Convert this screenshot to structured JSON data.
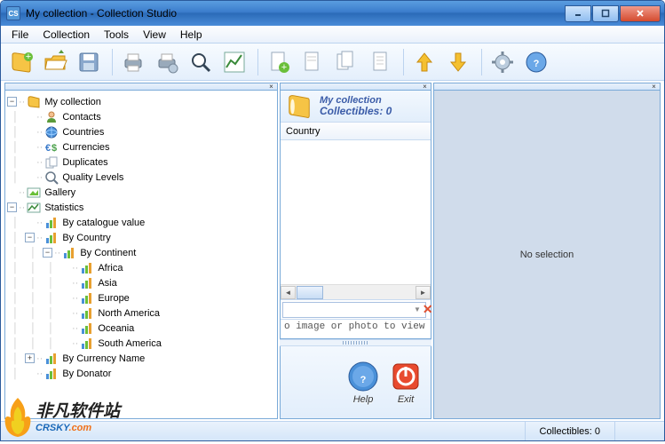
{
  "window": {
    "title": "My collection - Collection Studio",
    "app_icon": "CS"
  },
  "menu": [
    "File",
    "Collection",
    "Tools",
    "View",
    "Help"
  ],
  "toolbar": {
    "items": [
      "book-new",
      "folder-open",
      "save",
      "",
      "print",
      "print-setup",
      "search",
      "chart",
      "",
      "page-add",
      "page-remove",
      "page-copy",
      "page",
      "",
      "up",
      "down",
      "",
      "gear",
      "help"
    ]
  },
  "tree": [
    {
      "depth": 0,
      "exp": "-",
      "icon": "book",
      "label": "My collection"
    },
    {
      "depth": 1,
      "exp": "",
      "icon": "contacts",
      "label": "Contacts"
    },
    {
      "depth": 1,
      "exp": "",
      "icon": "globe",
      "label": "Countries"
    },
    {
      "depth": 1,
      "exp": "",
      "icon": "currency",
      "label": "Currencies"
    },
    {
      "depth": 1,
      "exp": "",
      "icon": "dup",
      "label": "Duplicates"
    },
    {
      "depth": 1,
      "exp": "",
      "icon": "quality",
      "label": "Quality Levels"
    },
    {
      "depth": 0,
      "exp": "",
      "icon": "gallery",
      "label": "Gallery"
    },
    {
      "depth": 0,
      "exp": "-",
      "icon": "stats",
      "label": "Statistics"
    },
    {
      "depth": 1,
      "exp": "",
      "icon": "bars",
      "label": "By catalogue value"
    },
    {
      "depth": 1,
      "exp": "-",
      "icon": "bars",
      "label": "By Country"
    },
    {
      "depth": 2,
      "exp": "-",
      "icon": "bars",
      "label": "By Continent"
    },
    {
      "depth": 3,
      "exp": "",
      "icon": "bars",
      "label": "Africa"
    },
    {
      "depth": 3,
      "exp": "",
      "icon": "bars",
      "label": "Asia"
    },
    {
      "depth": 3,
      "exp": "",
      "icon": "bars",
      "label": "Europe"
    },
    {
      "depth": 3,
      "exp": "",
      "icon": "bars",
      "label": "North America"
    },
    {
      "depth": 3,
      "exp": "",
      "icon": "bars",
      "label": "Oceania"
    },
    {
      "depth": 3,
      "exp": "",
      "icon": "bars",
      "label": "South America"
    },
    {
      "depth": 1,
      "exp": "+",
      "icon": "bars",
      "label": "By Currency Name"
    },
    {
      "depth": 1,
      "exp": "",
      "icon": "bars",
      "label": "By Donator"
    }
  ],
  "mid": {
    "title_line1": "My collection",
    "title_line2": "Collectibles: 0",
    "grid_header": "Country",
    "search_placeholder": "",
    "image_hint": "o image or photo to view",
    "help_label": "Help",
    "exit_label": "Exit"
  },
  "right": {
    "message": "No selection"
  },
  "status": {
    "collectibles": "Collectibles: 0"
  },
  "watermark": {
    "zh": "非凡软件站",
    "en_pre": "CRSKY",
    "en_dot": ".",
    "en_com": "com"
  }
}
